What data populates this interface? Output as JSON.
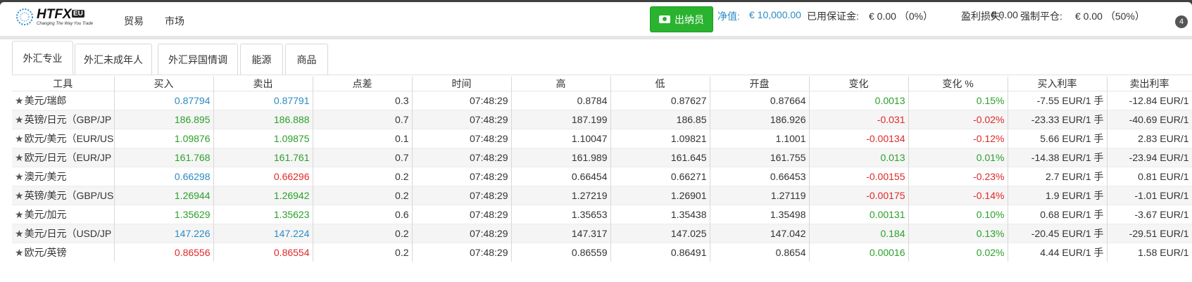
{
  "header": {
    "logo_text": "HTFX",
    "logo_badge": "EU",
    "logo_tagline": "Changing The Way You Trade",
    "nav": [
      "贸易",
      "市场"
    ],
    "cashier_label": "出纳员",
    "account": {
      "equity_label": "净值:",
      "equity_value": "€ 10,000.00",
      "margin_label": "已用保证金:",
      "margin_value": "€ 0.00 （0%）",
      "pl_label": "盈利损失:",
      "pl_value": "€ 0.00",
      "stopout_label": "强制平仓:",
      "stopout_value": "€ 0.00 （50%）"
    },
    "badge_count": "4"
  },
  "tabs": [
    {
      "label": "外汇专业",
      "active": true
    },
    {
      "label": "外汇未成年人",
      "active": false
    },
    {
      "label": "外汇异国情调",
      "active": false
    },
    {
      "label": "能源",
      "active": false
    },
    {
      "label": "商品",
      "active": false
    }
  ],
  "table": {
    "columns": [
      "工具",
      "买入",
      "卖出",
      "点差",
      "时间",
      "高",
      "低",
      "开盘",
      "变化",
      "变化 %",
      "买入利率",
      "卖出利率"
    ],
    "rows": [
      {
        "symbol": "美元/瑞郎",
        "bid": "0.87794",
        "ask": "0.87791",
        "spread": "0.3",
        "time": "07:48:29",
        "high": "0.8784",
        "low": "0.87627",
        "open": "0.87664",
        "change": "0.0013",
        "change_pct": "0.15%",
        "buy_rate": "-7.55 EUR/1 手",
        "sell_rate": "-12.84 EUR/1",
        "bid_color": "#2a8bc4",
        "ask_color": "#2a8bc4",
        "dir": "up"
      },
      {
        "symbol": "英镑/日元（GBP/JP",
        "bid": "186.895",
        "ask": "186.888",
        "spread": "0.7",
        "time": "07:48:29",
        "high": "187.199",
        "low": "186.85",
        "open": "186.926",
        "change": "-0.031",
        "change_pct": "-0.02%",
        "buy_rate": "-23.33 EUR/1 手",
        "sell_rate": "-40.69 EUR/1",
        "bid_color": "#2aa02a",
        "ask_color": "#2aa02a",
        "dir": "down"
      },
      {
        "symbol": "欧元/美元（EUR/US",
        "bid": "1.09876",
        "ask": "1.09875",
        "spread": "0.1",
        "time": "07:48:29",
        "high": "1.10047",
        "low": "1.09821",
        "open": "1.1001",
        "change": "-0.00134",
        "change_pct": "-0.12%",
        "buy_rate": "5.66 EUR/1 手",
        "sell_rate": "2.83 EUR/1",
        "bid_color": "#2aa02a",
        "ask_color": "#2aa02a",
        "dir": "down"
      },
      {
        "symbol": "欧元/日元（EUR/JP",
        "bid": "161.768",
        "ask": "161.761",
        "spread": "0.7",
        "time": "07:48:29",
        "high": "161.989",
        "low": "161.645",
        "open": "161.755",
        "change": "0.013",
        "change_pct": "0.01%",
        "buy_rate": "-14.38 EUR/1 手",
        "sell_rate": "-23.94 EUR/1",
        "bid_color": "#2aa02a",
        "ask_color": "#2aa02a",
        "dir": "up"
      },
      {
        "symbol": "澳元/美元",
        "bid": "0.66298",
        "ask": "0.66296",
        "spread": "0.2",
        "time": "07:48:29",
        "high": "0.66454",
        "low": "0.66271",
        "open": "0.66453",
        "change": "-0.00155",
        "change_pct": "-0.23%",
        "buy_rate": "2.7 EUR/1 手",
        "sell_rate": "0.81 EUR/1",
        "bid_color": "#2a8bc4",
        "ask_color": "#e02828",
        "dir": "down"
      },
      {
        "symbol": "英镑/美元（GBP/US",
        "bid": "1.26944",
        "ask": "1.26942",
        "spread": "0.2",
        "time": "07:48:29",
        "high": "1.27219",
        "low": "1.26901",
        "open": "1.27119",
        "change": "-0.00175",
        "change_pct": "-0.14%",
        "buy_rate": "1.9 EUR/1 手",
        "sell_rate": "-1.01 EUR/1",
        "bid_color": "#2aa02a",
        "ask_color": "#2aa02a",
        "dir": "down"
      },
      {
        "symbol": "美元/加元",
        "bid": "1.35629",
        "ask": "1.35623",
        "spread": "0.6",
        "time": "07:48:29",
        "high": "1.35653",
        "low": "1.35438",
        "open": "1.35498",
        "change": "0.00131",
        "change_pct": "0.10%",
        "buy_rate": "0.68 EUR/1 手",
        "sell_rate": "-3.67 EUR/1",
        "bid_color": "#2aa02a",
        "ask_color": "#2aa02a",
        "dir": "up"
      },
      {
        "symbol": "美元/日元（USD/JP",
        "bid": "147.226",
        "ask": "147.224",
        "spread": "0.2",
        "time": "07:48:29",
        "high": "147.317",
        "low": "147.025",
        "open": "147.042",
        "change": "0.184",
        "change_pct": "0.13%",
        "buy_rate": "-20.45 EUR/1 手",
        "sell_rate": "-29.51 EUR/1",
        "bid_color": "#2a8bc4",
        "ask_color": "#2a8bc4",
        "dir": "up"
      },
      {
        "symbol": "欧元/英镑",
        "bid": "0.86556",
        "ask": "0.86554",
        "spread": "0.2",
        "time": "07:48:29",
        "high": "0.86559",
        "low": "0.86491",
        "open": "0.8654",
        "change": "0.00016",
        "change_pct": "0.02%",
        "buy_rate": "4.44 EUR/1 手",
        "sell_rate": "1.58 EUR/1",
        "bid_color": "#e02828",
        "ask_color": "#e02828",
        "dir": "up"
      }
    ]
  },
  "colors": {
    "up": "#2aa02a",
    "down": "#e02828",
    "accent": "#2a8bc4",
    "cashier": "#2ab32f"
  }
}
